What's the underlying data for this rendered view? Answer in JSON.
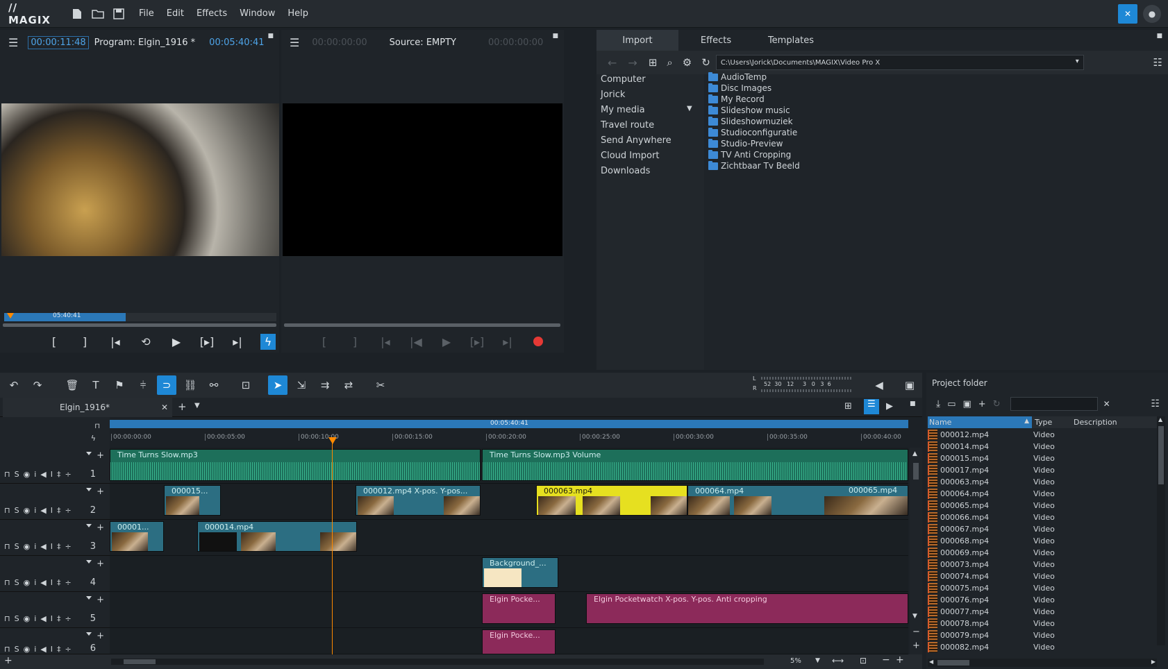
{
  "app": {
    "logo": "// MAGIX"
  },
  "menu": [
    "File",
    "Edit",
    "Effects",
    "Window",
    "Help"
  ],
  "program_monitor": {
    "timecode": "00:00:11:48",
    "title": "Program: Elgin_1916 *",
    "duration": "00:05:40:41",
    "scrub_label": "05:40:41"
  },
  "source_monitor": {
    "timecode_in": "00:00:00:00",
    "title": "Source: EMPTY",
    "timecode_out": "00:00:00:00"
  },
  "import": {
    "tabs": [
      "Import",
      "Effects",
      "Templates"
    ],
    "path": "C:\\Users\\Jorick\\Documents\\MAGIX\\Video Pro X",
    "nav": [
      "Computer",
      "Jorick",
      "My media",
      "Travel route",
      "Send Anywhere",
      "Cloud Import",
      "Downloads"
    ],
    "folders": [
      "AudioTemp",
      "Disc Images",
      "My Record",
      "Slideshow music",
      "Slideshowmuziek",
      "Studioconfiguratie",
      "Studio-Preview",
      "TV Anti Cropping",
      "Zichtbaar Tv Beeld"
    ]
  },
  "timeline": {
    "tab": "Elgin_1916*",
    "meter_labels": {
      "l": "L",
      "r": "R",
      "scale": "52  30   12     3   0   3  6"
    },
    "range_label": "00:05:40:41",
    "ruler": [
      "00:00:00:00",
      "00:00:05:00",
      "00:00:10:00",
      "00:00:15:00",
      "00:00:20:00",
      "00:00:25:00",
      "00:00:30:00",
      "00:00:35:00",
      "00:00:40:00"
    ],
    "tracks": [
      "1",
      "2",
      "3",
      "4",
      "5",
      "6"
    ],
    "track_ctrls": [
      "S",
      "i",
      "I",
      "‡",
      "÷"
    ],
    "clips": {
      "a1": "Time Turns Slow.mp3",
      "a2": "Time Turns Slow.mp3   Volume",
      "v2a": "000015...",
      "v2b": "000012.mp4   X-pos.  Y-pos...",
      "v2c": "000063.mp4",
      "v2d": "000064.mp4",
      "v2e": "000065.mp4",
      "v3a": "00001...",
      "v3b": "000014.mp4",
      "v4": "Background_...",
      "t5a": "Elgin Pocke...",
      "t5b": "Elgin Pocketwatch   X-pos.  Y-pos.  Anti cropping",
      "t6": "Elgin Pocke..."
    },
    "zoom": "5%"
  },
  "project_folder": {
    "title": "Project folder",
    "columns": [
      "Name",
      "Type",
      "Description"
    ],
    "rows": [
      [
        "000012.mp4",
        "Video"
      ],
      [
        "000014.mp4",
        "Video"
      ],
      [
        "000015.mp4",
        "Video"
      ],
      [
        "000017.mp4",
        "Video"
      ],
      [
        "000063.mp4",
        "Video"
      ],
      [
        "000064.mp4",
        "Video"
      ],
      [
        "000065.mp4",
        "Video"
      ],
      [
        "000066.mp4",
        "Video"
      ],
      [
        "000067.mp4",
        "Video"
      ],
      [
        "000068.mp4",
        "Video"
      ],
      [
        "000069.mp4",
        "Video"
      ],
      [
        "000073.mp4",
        "Video"
      ],
      [
        "000074.mp4",
        "Video"
      ],
      [
        "000075.mp4",
        "Video"
      ],
      [
        "000076.mp4",
        "Video"
      ],
      [
        "000077.mp4",
        "Video"
      ],
      [
        "000078.mp4",
        "Video"
      ],
      [
        "000079.mp4",
        "Video"
      ],
      [
        "000082.mp4",
        "Video"
      ]
    ]
  },
  "colors": {
    "accent": "#1e88d6",
    "record": "#e53935",
    "playhead": "#ff8a00"
  }
}
